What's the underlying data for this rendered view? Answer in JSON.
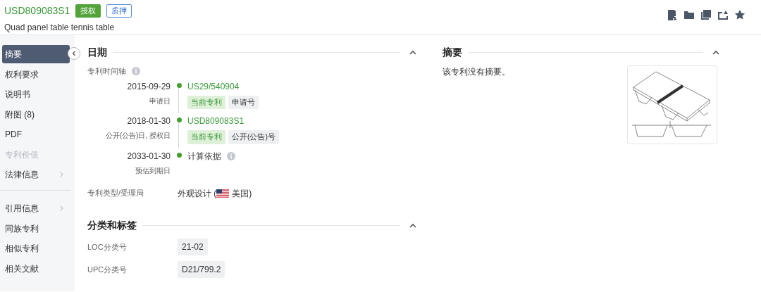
{
  "header": {
    "patent_number": "USD809083S1",
    "badges": [
      {
        "text": "授权",
        "kind": "solid"
      },
      {
        "text": "质押",
        "kind": "outline"
      }
    ],
    "title": "Quad panel table tennis table"
  },
  "sidebar": {
    "groups": [
      [
        {
          "label": "摘要",
          "selected": true,
          "disabled": false,
          "expandable": false
        },
        {
          "label": "权利要求",
          "selected": false,
          "disabled": false,
          "expandable": false
        },
        {
          "label": "说明书",
          "selected": false,
          "disabled": false,
          "expandable": false
        },
        {
          "label": "附图 (8)",
          "selected": false,
          "disabled": false,
          "expandable": false
        },
        {
          "label": "PDF",
          "selected": false,
          "disabled": false,
          "expandable": false
        },
        {
          "label": "专利价值",
          "selected": false,
          "disabled": true,
          "expandable": false
        },
        {
          "label": "法律信息",
          "selected": false,
          "disabled": false,
          "expandable": true
        }
      ],
      [
        {
          "label": "引用信息",
          "selected": false,
          "disabled": false,
          "expandable": true
        },
        {
          "label": "同族专利",
          "selected": false,
          "disabled": false,
          "expandable": false
        },
        {
          "label": "相似专利",
          "selected": false,
          "disabled": false,
          "expandable": false
        },
        {
          "label": "相关文献",
          "selected": false,
          "disabled": false,
          "expandable": false
        }
      ]
    ]
  },
  "dates": {
    "heading": "日期",
    "timeline_label": "专利时间轴",
    "timeline": [
      {
        "date": "2015-09-29",
        "date_label": "申请日",
        "kind": "link",
        "number": "US29/540904",
        "tags": [
          {
            "text": "当前专利",
            "kind": "current"
          },
          {
            "text": "申请号",
            "kind": "plain"
          }
        ]
      },
      {
        "date": "2018-01-30",
        "date_label": "公开(公告)日, 授权日",
        "kind": "link",
        "number": "USD809083S1",
        "tags": [
          {
            "text": "当前专利",
            "kind": "current"
          },
          {
            "text": "公开(公告)号",
            "kind": "plain"
          }
        ]
      },
      {
        "date": "2033-01-30",
        "date_label": "预估到期日",
        "kind": "info",
        "number": "计算依据"
      }
    ],
    "type_label": "专利类型/受理局",
    "type_value": "外观设计 (",
    "office": "美国)"
  },
  "classification": {
    "heading": "分类和标签",
    "rows": [
      {
        "label": "LOC分类号",
        "value": "21-02"
      },
      {
        "label": "UPC分类号",
        "value": "D21/799.2"
      }
    ]
  },
  "abstract": {
    "heading": "摘要",
    "text": "该专利没有摘要。"
  }
}
